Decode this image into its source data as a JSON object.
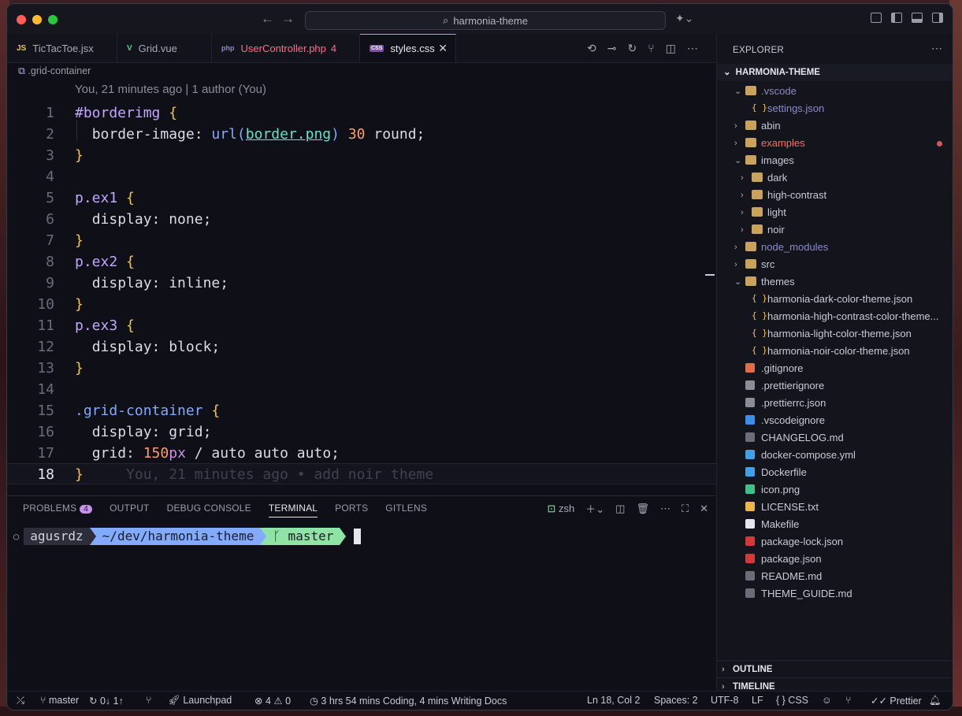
{
  "window": {
    "search_text": "harmonia-theme"
  },
  "tabs": [
    {
      "label": "TicTacToe.jsx",
      "icon": "JS",
      "color": "#f5c542"
    },
    {
      "label": "Grid.vue",
      "icon": "V",
      "color": "#42d392"
    },
    {
      "label": "UserController.php",
      "badge": "4",
      "icon": "php",
      "color": "#ff6b8b"
    },
    {
      "label": "styles.css",
      "icon": "CSS",
      "color": "#c792ea"
    }
  ],
  "breadcrumb": ".grid-container",
  "blame_header": "You, 21 minutes ago | 1 author (You)",
  "code": {
    "line_numbers": [
      "1",
      "2",
      "3",
      "4",
      "5",
      "6",
      "7",
      "8",
      "9",
      "10",
      "11",
      "12",
      "13",
      "14",
      "15",
      "16",
      "17",
      "18"
    ],
    "l1_sel": "#borderimg",
    "l2_prop": "border-image: ",
    "l2_fn": "url(",
    "l2_url": "border.png",
    "l2_fn_close": ")",
    "l2_num": "30",
    "l2_rest": " round;",
    "l5_sel": "p.ex1",
    "l6": "display: none;",
    "l8_sel": "p.ex2",
    "l9": "display: inline;",
    "l11_sel": "p.ex3",
    "l12": "display: block;",
    "l15_sel": ".grid-container",
    "l16": "display: grid;",
    "l17_prop": "grid: ",
    "l17_num": "150",
    "l17_unit": "px",
    "l17_rest": " / auto auto auto;",
    "open_brace": "{",
    "close_brace": "}",
    "inline_blame": "You, 21 minutes ago • add noir theme"
  },
  "panel": {
    "tabs": [
      "PROBLEMS",
      "OUTPUT",
      "DEBUG CONSOLE",
      "TERMINAL",
      "PORTS",
      "GITLENS"
    ],
    "problems_count": "4",
    "active_tab": "TERMINAL",
    "shell": "zsh",
    "prompt_user": "agusrdz",
    "prompt_path": "~/dev/harmonia-theme",
    "prompt_branch": "ᚴ master"
  },
  "explorer": {
    "title": "EXPLORER",
    "root": "HARMONIA-THEME",
    "items": [
      {
        "name": ".vscode",
        "type": "folder-open",
        "depth": 0,
        "color": "#8a8ccc"
      },
      {
        "name": "settings.json",
        "type": "json",
        "depth": 1,
        "color": "#8a8ccc"
      },
      {
        "name": "abin",
        "type": "folder",
        "depth": 0
      },
      {
        "name": "examples",
        "type": "folder",
        "depth": 0,
        "color": "#ff6b6b",
        "modified": true
      },
      {
        "name": "images",
        "type": "folder-open",
        "depth": 0
      },
      {
        "name": "dark",
        "type": "folder",
        "depth": 1
      },
      {
        "name": "high-contrast",
        "type": "folder",
        "depth": 1
      },
      {
        "name": "light",
        "type": "folder",
        "depth": 1
      },
      {
        "name": "noir",
        "type": "folder",
        "depth": 1
      },
      {
        "name": "node_modules",
        "type": "folder",
        "depth": 0,
        "color": "#8a8ccc"
      },
      {
        "name": "src",
        "type": "folder",
        "depth": 0
      },
      {
        "name": "themes",
        "type": "folder-open",
        "depth": 0
      },
      {
        "name": "harmonia-dark-color-theme.json",
        "type": "json",
        "depth": 1
      },
      {
        "name": "harmonia-high-contrast-color-theme...",
        "type": "json",
        "depth": 1
      },
      {
        "name": "harmonia-light-color-theme.json",
        "type": "json",
        "depth": 1
      },
      {
        "name": "harmonia-noir-color-theme.json",
        "type": "json",
        "depth": 1
      },
      {
        "name": ".gitignore",
        "type": "file",
        "depth": 0,
        "icon_color": "#e06c4a"
      },
      {
        "name": ".prettierignore",
        "type": "file",
        "depth": 0,
        "icon_color": "#8a8c96"
      },
      {
        "name": ".prettierrc.json",
        "type": "file",
        "depth": 0,
        "icon_color": "#8a8c96"
      },
      {
        "name": ".vscodeignore",
        "type": "file",
        "depth": 0,
        "icon_color": "#3b8eea"
      },
      {
        "name": "CHANGELOG.md",
        "type": "file",
        "depth": 0,
        "icon_color": "#6a6c78"
      },
      {
        "name": "docker-compose.yml",
        "type": "file",
        "depth": 0,
        "icon_color": "#3fa0e8"
      },
      {
        "name": "Dockerfile",
        "type": "file",
        "depth": 0,
        "icon_color": "#3fa0e8"
      },
      {
        "name": "icon.png",
        "type": "file",
        "depth": 0,
        "icon_color": "#3fc08a"
      },
      {
        "name": "LICENSE.txt",
        "type": "file",
        "depth": 0,
        "icon_color": "#e8b84a"
      },
      {
        "name": "Makefile",
        "type": "file",
        "depth": 0,
        "icon_color": "#e6e7ee"
      },
      {
        "name": "package-lock.json",
        "type": "file",
        "depth": 0,
        "icon_color": "#d03a3a"
      },
      {
        "name": "package.json",
        "type": "file",
        "depth": 0,
        "icon_color": "#d03a3a"
      },
      {
        "name": "README.md",
        "type": "file",
        "depth": 0,
        "icon_color": "#6a6c78"
      },
      {
        "name": "THEME_GUIDE.md",
        "type": "file",
        "depth": 0,
        "icon_color": "#6a6c78"
      }
    ],
    "outline": "OUTLINE",
    "timeline": "TIMELINE"
  },
  "statusbar": {
    "branch": "master",
    "sync": "0↓ 1↑",
    "launchpad": "Launchpad",
    "errors": "4",
    "warnings": "0",
    "coding": "3 hrs 54 mins Coding, 4 mins Writing Docs",
    "position": "Ln 18, Col 2",
    "spaces": "Spaces: 2",
    "encoding": "UTF-8",
    "eol": "LF",
    "language": "CSS",
    "prettier": "Prettier"
  }
}
